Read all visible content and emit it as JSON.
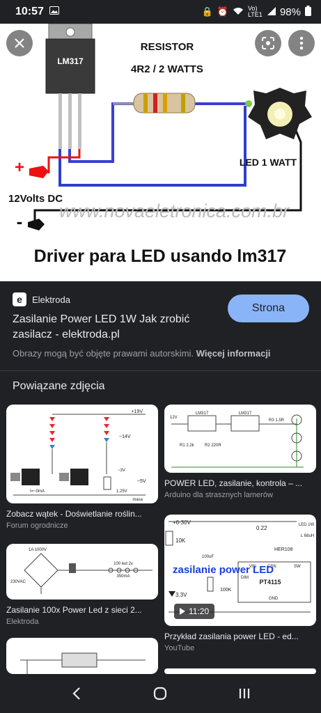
{
  "status": {
    "time": "10:57",
    "network": "Vo) LTE1",
    "battery": "98%"
  },
  "hero": {
    "ic_label": "LM317",
    "resistor_label": "RESISTOR",
    "resistor_value": "4R2 / 2 WATTS",
    "led_label": "LED 1 WATT",
    "plus_label": "+",
    "supply_label": "12Volts DC",
    "minus_label": "-",
    "watermark": "www.novaeletronica.com.br",
    "caption": "Driver para LED usando lm317"
  },
  "result": {
    "source": "Elektroda",
    "favicon_letter": "e",
    "title": "Zasilanie Power LED 1W Jak zrobić zasilacz - elektroda.pl",
    "visit_button": "Strona",
    "copyright_text": "Obrazy mogą być objęte prawami autorskimi.",
    "more_info": "Więcej informacji"
  },
  "related": {
    "heading": "Powiązane zdjęcia",
    "cards": [
      {
        "title": "Zobacz wątek - Doświetlanie roślin...",
        "source": "Forum ogrodnicze",
        "labels": [
          "+19V",
          "~14V",
          "~5V",
          "masa",
          "I=~0mA",
          "1.25V",
          "~3V"
        ]
      },
      {
        "title": "POWER LED, zasilanie, kontrola – ...",
        "source": "Arduino dla strasznych lamerów",
        "labels": [
          "LM317",
          "LM317",
          "R1 2.2k",
          "R2 220R",
          "R3 1.5R",
          "12V"
        ]
      },
      {
        "title": "Zasilanie 100x Power Led z sieci 2...",
        "source": "Elektroda",
        "labels": [
          "100 led 2v",
          "350mA",
          "230VAC",
          "1A 1000V"
        ]
      },
      {
        "title": "Przykład zasilania power LED - ed...",
        "source": "YouTube",
        "duration": "11:20",
        "overlay_text": "zasilanie power LED",
        "labels": [
          "+6-30V",
          "10K",
          "0.22",
          "HER108",
          "LED 1W",
          "100uF",
          "100K",
          "3.3V",
          "PT4115",
          "DIM",
          "VIN",
          "CSN",
          "GND",
          "SW",
          "L 68uH"
        ]
      }
    ]
  },
  "colors": {
    "background": "#202124",
    "accent": "#8ab4f8",
    "text": "#e8eaed",
    "secondary_text": "#9aa0a6"
  },
  "icons": {
    "close": "close-icon",
    "lens": "lens-icon",
    "more": "more-vert-icon",
    "back": "back-icon",
    "home": "home-icon",
    "recents": "recents-icon"
  }
}
